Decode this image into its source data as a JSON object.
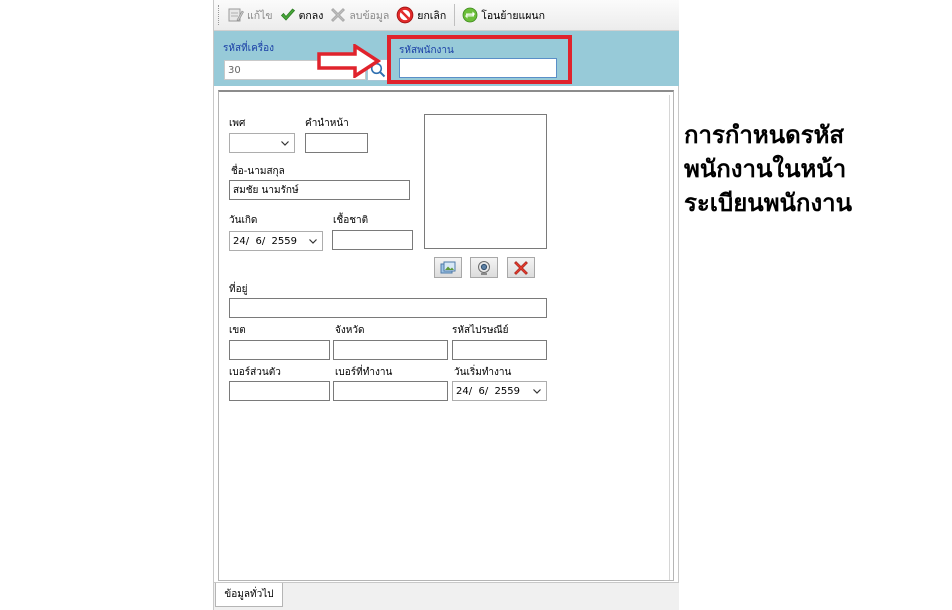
{
  "toolbar": {
    "edit_label": "แก้ไข",
    "ok_label": "ตกลง",
    "delete_label": "ลบข้อมูล",
    "cancel_label": "ยกเลิก",
    "transfer_label": "โอนย้ายแผนก"
  },
  "header": {
    "machine_code_label": "รหัสที่เครื่อง",
    "machine_code_value": "30",
    "employee_code_label": "รหัสพนักงาน",
    "employee_code_value": ""
  },
  "form": {
    "gender_label": "เพศ",
    "gender_value": "",
    "prefix_label": "คำนำหน้า",
    "prefix_value": "",
    "fullname_label": "ชื่อ-นามสกุล",
    "fullname_value": "สมชัย นามรักษ์",
    "birthdate_label": "วันเกิด",
    "birthdate_value": "24/  6/  2559",
    "nationality_label": "เชื้อชาติ",
    "nationality_value": "",
    "address_label": "ที่อยู่",
    "address_value": "",
    "district_label": "เขต",
    "district_value": "",
    "province_label": "จังหวัด",
    "province_value": "",
    "postcode_label": "รหัสไปรษณีย์",
    "postcode_value": "",
    "mobile_label": "เบอร์ส่วนตัว",
    "mobile_value": "",
    "work_phone_label": "เบอร์ที่ทำงาน",
    "work_phone_value": "",
    "start_date_label": "วันเริ่มทำงาน",
    "start_date_value": "24/  6/  2559"
  },
  "tabs": {
    "general_label": "ข้อมูลทั่วไป"
  },
  "caption": {
    "line1": "การกำหนดรหัส",
    "line2": "พนักงานในหน้า",
    "line3": "ระเบียนพนักงาน"
  },
  "colors": {
    "header_bg": "#97cad8",
    "header_label": "#1a3fa6",
    "highlight": "#e0232c"
  }
}
